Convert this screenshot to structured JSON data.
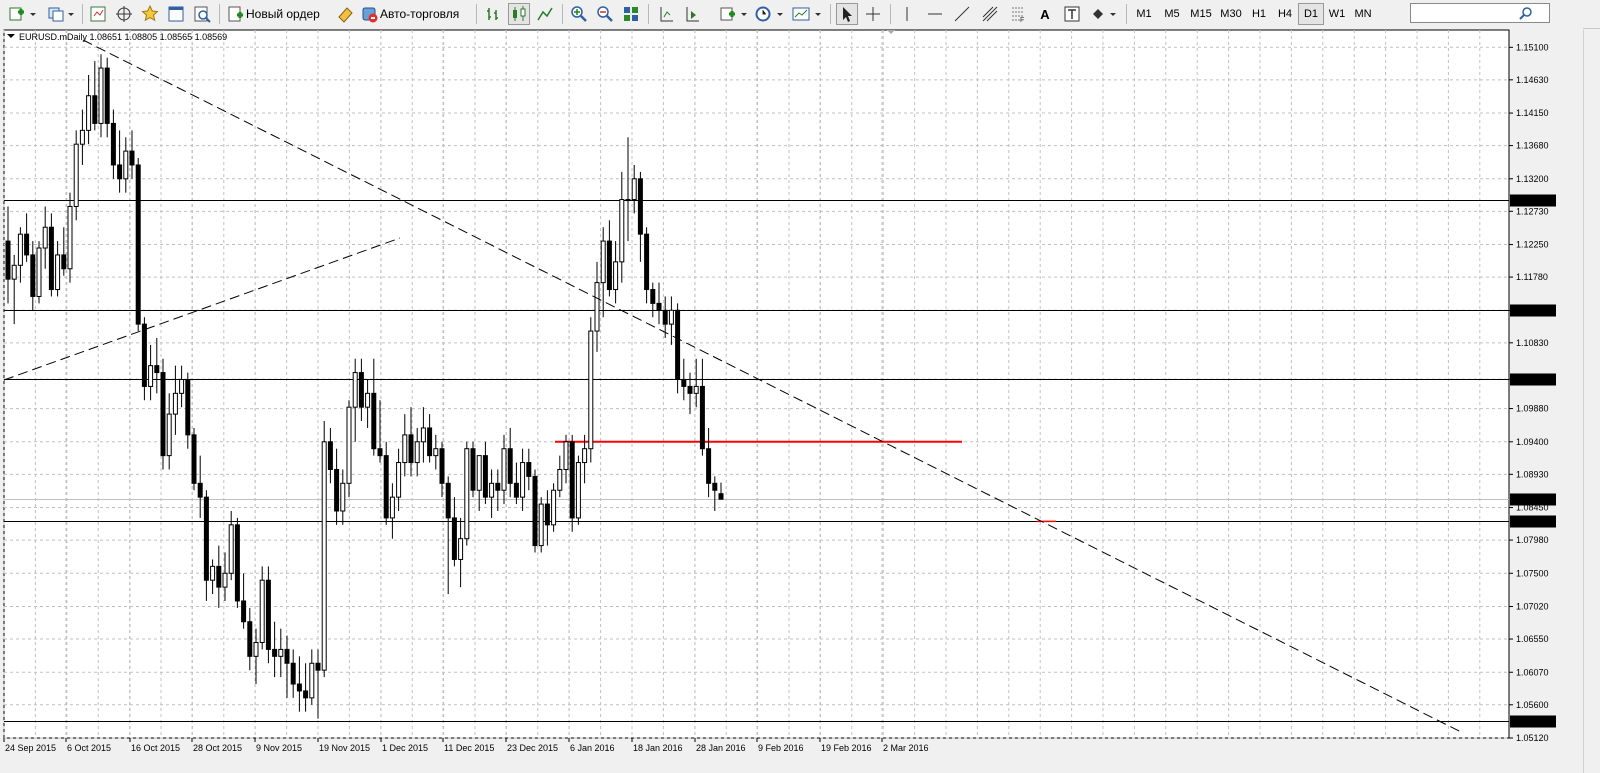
{
  "toolbar": {
    "new_order": "Новый ордер",
    "auto_trading": "Авто-торговля",
    "timeframes": [
      "M1",
      "M5",
      "M15",
      "M30",
      "H1",
      "H4",
      "D1",
      "W1",
      "MN"
    ],
    "active_timeframe": "D1",
    "search_value": ""
  },
  "chart": {
    "header": "EURUSD.mDaily  1.08651 1.08805 1.08565 1.08569",
    "price_axis": [
      "1.15100",
      "1.14630",
      "1.14150",
      "1.13680",
      "1.13200",
      "1.12730",
      "1.12250",
      "1.11780",
      "1.11300",
      "1.10830",
      "1.10306",
      "1.09880",
      "1.09400",
      "1.08930",
      "1.08450",
      "1.07980",
      "1.07500",
      "1.07020",
      "1.06550",
      "1.06070",
      "1.05600",
      "1.05120"
    ],
    "date_axis": [
      "24 Sep 2015",
      "6 Oct 2015",
      "16 Oct 2015",
      "28 Oct 2015",
      "9 Nov 2015",
      "19 Nov 2015",
      "1 Dec 2015",
      "11 Dec 2015",
      "23 Dec 2015",
      "6 Jan 2016",
      "18 Jan 2016",
      "28 Jan 2016",
      "9 Feb 2016",
      "19 Feb 2016",
      "2 Mar 2016"
    ],
    "levels": [
      "1.12900",
      "1.11300",
      "1.10306",
      "1.08250",
      "1.05360"
    ],
    "current_price": "1.08569",
    "red_level": "1.09400",
    "colors": {
      "background": "#ffffff",
      "grid": "#c0c0c0",
      "candle": "#000000",
      "red_line": "#ff0000",
      "level_label_bg": "#000000",
      "level_label_text": "#ffffff"
    }
  },
  "chart_data": {
    "type": "candlestick",
    "symbol": "EURUSD.m",
    "timeframe": "Daily",
    "ylim": [
      1.0512,
      1.1535
    ],
    "x": [
      "24 Sep 2015",
      "6 Oct 2015",
      "16 Oct 2015",
      "28 Oct 2015",
      "9 Nov 2015",
      "19 Nov 2015",
      "1 Dec 2015",
      "11 Dec 2015",
      "23 Dec 2015",
      "6 Jan 2016",
      "18 Jan 2016",
      "28 Jan 2016",
      "9 Feb 2016",
      "19 Feb 2016",
      "2 Mar 2016"
    ],
    "last_ohlc": {
      "open": 1.08651,
      "high": 1.08805,
      "low": 1.08565,
      "close": 1.08569
    },
    "candles": [
      [
        1.123,
        1.128,
        1.114,
        1.1175
      ],
      [
        1.1175,
        1.121,
        1.111,
        1.1195
      ],
      [
        1.1195,
        1.125,
        1.117,
        1.124
      ],
      [
        1.124,
        1.127,
        1.12,
        1.121
      ],
      [
        1.121,
        1.123,
        1.113,
        1.115
      ],
      [
        1.115,
        1.123,
        1.114,
        1.122
      ],
      [
        1.122,
        1.128,
        1.119,
        1.125
      ],
      [
        1.125,
        1.127,
        1.115,
        1.116
      ],
      [
        1.116,
        1.123,
        1.115,
        1.121
      ],
      [
        1.121,
        1.125,
        1.118,
        1.119
      ],
      [
        1.119,
        1.13,
        1.117,
        1.128
      ],
      [
        1.128,
        1.139,
        1.126,
        1.137
      ],
      [
        1.137,
        1.142,
        1.134,
        1.139
      ],
      [
        1.139,
        1.147,
        1.137,
        1.144
      ],
      [
        1.144,
        1.149,
        1.139,
        1.14
      ],
      [
        1.14,
        1.15,
        1.138,
        1.148
      ],
      [
        1.148,
        1.1495,
        1.138,
        1.14
      ],
      [
        1.14,
        1.142,
        1.132,
        1.134
      ],
      [
        1.134,
        1.139,
        1.13,
        1.132
      ],
      [
        1.132,
        1.138,
        1.13,
        1.136
      ],
      [
        1.136,
        1.139,
        1.132,
        1.134
      ],
      [
        1.134,
        1.135,
        1.11,
        1.111
      ],
      [
        1.111,
        1.112,
        1.1,
        1.102
      ],
      [
        1.102,
        1.108,
        1.1,
        1.105
      ],
      [
        1.105,
        1.109,
        1.101,
        1.104
      ],
      [
        1.104,
        1.106,
        1.09,
        1.092
      ],
      [
        1.092,
        1.101,
        1.09,
        1.098
      ],
      [
        1.098,
        1.105,
        1.095,
        1.101
      ],
      [
        1.101,
        1.105,
        1.099,
        1.103
      ],
      [
        1.103,
        1.104,
        1.093,
        1.095
      ],
      [
        1.095,
        1.096,
        1.087,
        1.088
      ],
      [
        1.088,
        1.092,
        1.083,
        1.086
      ],
      [
        1.086,
        1.087,
        1.071,
        1.074
      ],
      [
        1.074,
        1.077,
        1.072,
        1.076
      ],
      [
        1.076,
        1.079,
        1.07,
        1.073
      ],
      [
        1.073,
        1.078,
        1.071,
        1.075
      ],
      [
        1.075,
        1.084,
        1.074,
        1.082
      ],
      [
        1.082,
        1.083,
        1.07,
        1.071
      ],
      [
        1.071,
        1.075,
        1.067,
        1.068
      ],
      [
        1.068,
        1.07,
        1.061,
        1.063
      ],
      [
        1.063,
        1.067,
        1.059,
        1.065
      ],
      [
        1.065,
        1.076,
        1.064,
        1.074
      ],
      [
        1.074,
        1.076,
        1.062,
        1.064
      ],
      [
        1.064,
        1.068,
        1.06,
        1.063
      ],
      [
        1.063,
        1.067,
        1.06,
        1.064
      ],
      [
        1.064,
        1.066,
        1.057,
        1.062
      ],
      [
        1.062,
        1.064,
        1.057,
        1.059
      ],
      [
        1.059,
        1.063,
        1.055,
        1.058
      ],
      [
        1.058,
        1.062,
        1.055,
        1.057
      ],
      [
        1.057,
        1.064,
        1.056,
        1.062
      ],
      [
        1.062,
        1.064,
        1.054,
        1.061
      ],
      [
        1.061,
        1.097,
        1.06,
        1.094
      ],
      [
        1.094,
        1.096,
        1.088,
        1.09
      ],
      [
        1.09,
        1.093,
        1.082,
        1.084
      ],
      [
        1.084,
        1.09,
        1.082,
        1.088
      ],
      [
        1.088,
        1.1,
        1.086,
        1.099
      ],
      [
        1.099,
        1.106,
        1.094,
        1.104
      ],
      [
        1.104,
        1.106,
        1.097,
        1.099
      ],
      [
        1.099,
        1.103,
        1.096,
        1.101
      ],
      [
        1.101,
        1.106,
        1.092,
        1.093
      ],
      [
        1.093,
        1.1,
        1.091,
        1.092
      ],
      [
        1.092,
        1.094,
        1.082,
        1.083
      ],
      [
        1.083,
        1.088,
        1.08,
        1.086
      ],
      [
        1.086,
        1.093,
        1.084,
        1.091
      ],
      [
        1.091,
        1.098,
        1.089,
        1.095
      ],
      [
        1.095,
        1.099,
        1.089,
        1.091
      ],
      [
        1.091,
        1.096,
        1.089,
        1.094
      ],
      [
        1.094,
        1.099,
        1.091,
        1.096
      ],
      [
        1.096,
        1.098,
        1.091,
        1.092
      ],
      [
        1.092,
        1.095,
        1.09,
        1.093
      ],
      [
        1.093,
        1.094,
        1.086,
        1.088
      ],
      [
        1.088,
        1.089,
        1.072,
        1.083
      ],
      [
        1.083,
        1.086,
        1.076,
        1.077
      ],
      [
        1.077,
        1.083,
        1.073,
        1.08
      ],
      [
        1.08,
        1.094,
        1.079,
        1.093
      ],
      [
        1.093,
        1.094,
        1.086,
        1.087
      ],
      [
        1.087,
        1.092,
        1.084,
        1.092
      ],
      [
        1.092,
        1.094,
        1.085,
        1.086
      ],
      [
        1.086,
        1.09,
        1.083,
        1.088
      ],
      [
        1.088,
        1.09,
        1.084,
        1.087
      ],
      [
        1.087,
        1.095,
        1.085,
        1.093
      ],
      [
        1.093,
        1.096,
        1.086,
        1.088
      ],
      [
        1.088,
        1.091,
        1.085,
        1.086
      ],
      [
        1.086,
        1.093,
        1.084,
        1.091
      ],
      [
        1.091,
        1.093,
        1.087,
        1.089
      ],
      [
        1.089,
        1.09,
        1.078,
        1.079
      ],
      [
        1.079,
        1.086,
        1.078,
        1.085
      ],
      [
        1.085,
        1.087,
        1.079,
        1.082
      ],
      [
        1.082,
        1.088,
        1.081,
        1.087
      ],
      [
        1.087,
        1.092,
        1.086,
        1.09
      ],
      [
        1.09,
        1.095,
        1.088,
        1.094
      ],
      [
        1.094,
        1.095,
        1.081,
        1.083
      ],
      [
        1.083,
        1.092,
        1.082,
        1.091
      ],
      [
        1.091,
        1.095,
        1.088,
        1.093
      ],
      [
        1.093,
        1.112,
        1.091,
        1.11
      ],
      [
        1.11,
        1.12,
        1.107,
        1.117
      ],
      [
        1.117,
        1.125,
        1.112,
        1.123
      ],
      [
        1.123,
        1.126,
        1.115,
        1.116
      ],
      [
        1.116,
        1.123,
        1.114,
        1.12
      ],
      [
        1.12,
        1.133,
        1.117,
        1.129
      ],
      [
        1.129,
        1.138,
        1.123,
        1.129
      ],
      [
        1.129,
        1.134,
        1.127,
        1.132
      ],
      [
        1.132,
        1.133,
        1.12,
        1.124
      ],
      [
        1.124,
        1.125,
        1.114,
        1.116
      ],
      [
        1.116,
        1.117,
        1.112,
        1.114
      ],
      [
        1.114,
        1.117,
        1.111,
        1.113
      ],
      [
        1.113,
        1.115,
        1.109,
        1.111
      ],
      [
        1.111,
        1.115,
        1.108,
        1.113
      ],
      [
        1.113,
        1.114,
        1.101,
        1.103
      ],
      [
        1.103,
        1.106,
        1.1,
        1.102
      ],
      [
        1.102,
        1.104,
        1.098,
        1.101
      ],
      [
        1.101,
        1.106,
        1.099,
        1.102
      ],
      [
        1.102,
        1.106,
        1.092,
        1.093
      ],
      [
        1.093,
        1.096,
        1.086,
        1.088
      ],
      [
        1.088,
        1.089,
        1.084,
        1.087
      ],
      [
        1.0865,
        1.0881,
        1.0857,
        1.0857
      ]
    ]
  }
}
